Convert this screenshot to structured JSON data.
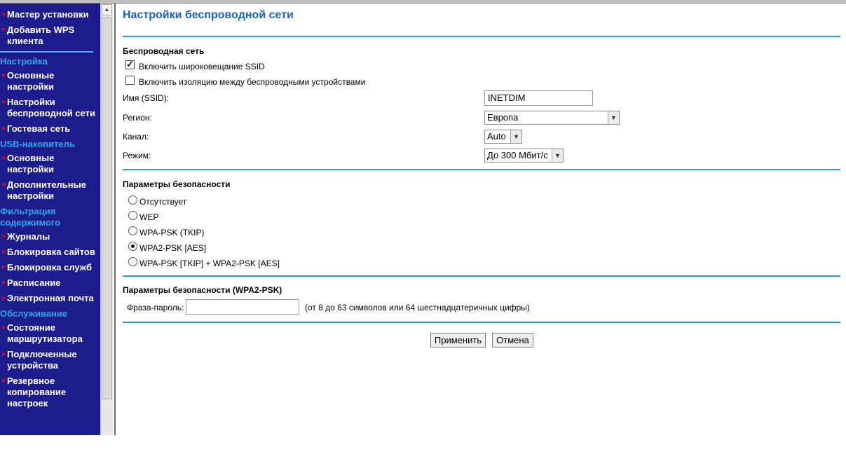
{
  "sidebar": {
    "items_top": [
      {
        "label": "Мастер установки"
      },
      {
        "label": "Добавить WPS клиента"
      }
    ],
    "sections": [
      {
        "heading": "Настройка",
        "items": [
          "Основные настройки",
          "Настройки беспроводной сети",
          "Гостевая сеть"
        ]
      },
      {
        "heading": "USB-накопитель",
        "items": [
          "Основные настройки",
          "Дополнительные настройки"
        ]
      },
      {
        "heading": "Фильтрация содержимого",
        "items": [
          "Журналы",
          "Блокировка сайтов",
          "Блокировка служб",
          "Расписание",
          "Электронная почта"
        ]
      },
      {
        "heading": "Обслуживание",
        "items": [
          "Состояние маршрутизатора",
          "Подключенные устройства",
          "Резервное копирование настроек"
        ]
      }
    ]
  },
  "main": {
    "title": "Настройки беспроводной сети",
    "wireless": {
      "heading": "Беспроводная сеть",
      "ssid_broadcast_label": "Включить широковещание SSID",
      "ssid_broadcast_checked": true,
      "isolation_label": "Включить изоляцию между беспроводными устройствами",
      "isolation_checked": false,
      "ssid_label": "Имя (SSID):",
      "ssid_value": "INETDIM",
      "region_label": "Регион:",
      "region_value": "Европа",
      "channel_label": "Канал:",
      "channel_value": "Auto",
      "mode_label": "Режим:",
      "mode_value": "До 300 Мбит/с"
    },
    "security": {
      "heading": "Параметры безопасности",
      "options": [
        "Отсутствует",
        "WEP",
        "WPA-PSK (TKIP)",
        "WPA2-PSK [AES]",
        "WPA-PSK [TKIP] + WPA2-PSK [AES]"
      ],
      "selected_index": 3
    },
    "wpa2": {
      "heading": "Параметры безопасности (WPA2-PSK)",
      "passphrase_label": "Фраза-пароль:",
      "passphrase_hint": "(от 8 до 63 символов или 64 шестнадцатеричных цифры)"
    },
    "buttons": {
      "apply": "Применить",
      "cancel": "Отмена"
    }
  },
  "colors": {
    "sidebar_bg": "#1c1c8c",
    "sidebar_heading": "#2aa9f0",
    "bullet": "#e0001b",
    "title": "#1a62b4",
    "rule": "#2a9fd1"
  }
}
